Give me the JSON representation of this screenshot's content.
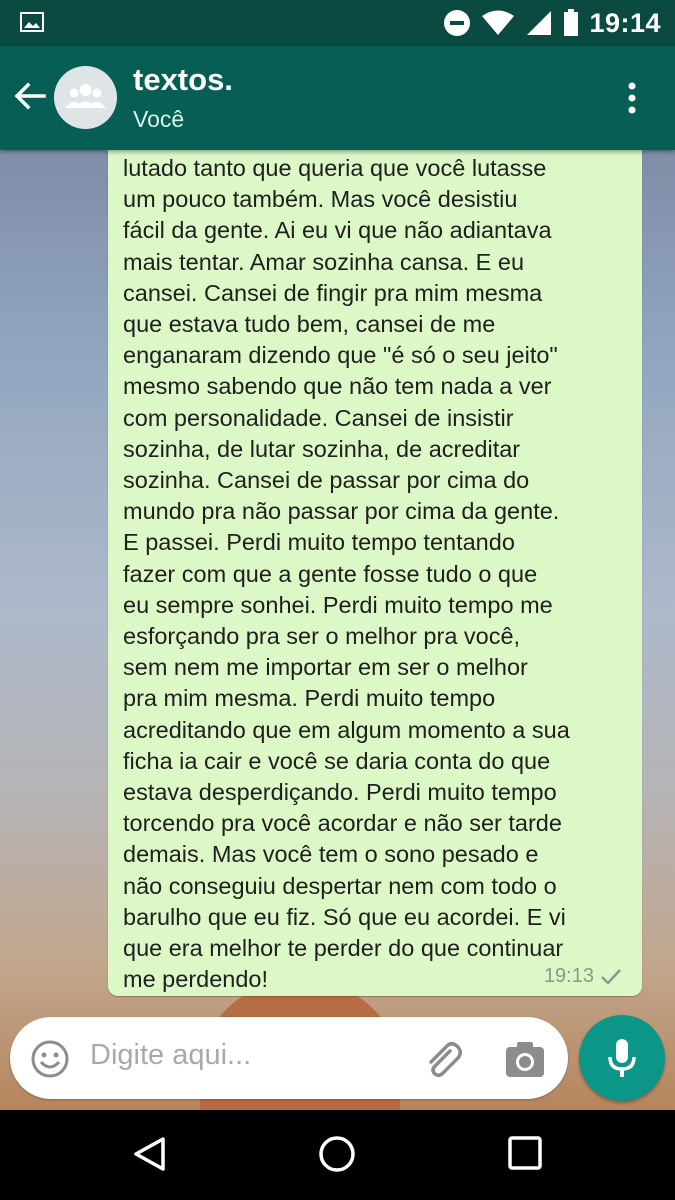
{
  "status_bar": {
    "time": "19:14",
    "icons": [
      "image-icon",
      "do-not-disturb-icon",
      "wifi-icon",
      "signal-icon",
      "battery-icon"
    ]
  },
  "header": {
    "title": "textos.",
    "subtitle": "Você",
    "avatar_icon": "group-avatar-icon",
    "back_icon": "back-arrow-icon",
    "menu_icon": "more-vert-icon"
  },
  "message": {
    "text": "lutado tanto que queria que você lutasse\num pouco também. Mas você desistiu\nfácil da gente. Ai eu vi que não adiantava\nmais tentar. Amar sozinha cansa. E eu\ncansei. Cansei de fingir pra mim mesma\nque estava tudo bem, cansei de me\nenganaram dizendo que \"é só o seu jeito\"\nmesmo sabendo que não tem nada a ver\ncom personalidade. Cansei de insistir\nsozinha, de lutar sozinha, de acreditar\nsozinha. Cansei de passar por cima do\nmundo pra não passar por cima da gente.\nE passei. Perdi muito tempo tentando\nfazer com que a gente fosse tudo o que\neu sempre sonhei. Perdi muito tempo me\nesforçando pra ser o melhor pra você,\nsem nem me importar em ser o melhor\npra mim mesma. Perdi muito tempo\nacreditando que em algum momento a sua\nficha ia cair e você se daria conta do que\nestava desperdiçando. Perdi muito tempo\ntorcendo pra você acordar e não ser tarde\ndemais. Mas você tem o sono pesado e\nnão conseguiu despertar nem com todo o\nbarulho que eu fiz. Só que eu acordei. E vi\nque era melhor te perder do que continuar\nme perdendo!",
    "time": "19:13",
    "status_icon": "sent-check-icon"
  },
  "composer": {
    "placeholder": "Digite aqui...",
    "emoji_icon": "emoji-icon",
    "attach_icon": "paperclip-icon",
    "camera_icon": "camera-icon",
    "mic_icon": "microphone-icon"
  },
  "navigation": {
    "back_icon": "nav-back-icon",
    "home_icon": "nav-home-icon",
    "recents_icon": "nav-recents-icon"
  },
  "colors": {
    "primary": "#075e54",
    "status_bar": "#0a4a40",
    "bubble": "#dcf8c6",
    "accent": "#0b9688"
  }
}
